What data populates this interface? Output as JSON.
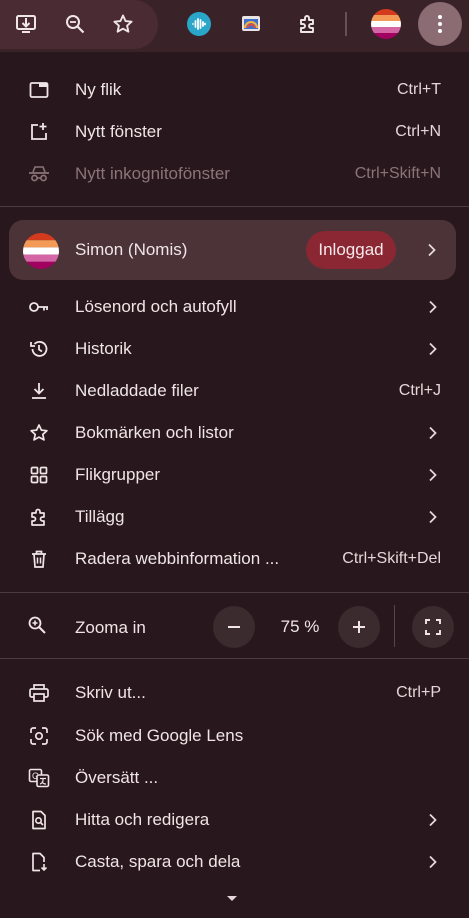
{
  "toolbar": {
    "icons": [
      "download-icon",
      "zoom-icon",
      "bookmark-star-icon",
      "extension-audio-icon",
      "extension-cast-icon",
      "extensions-puzzle-icon",
      "profile-avatar",
      "kebab-menu-icon"
    ]
  },
  "menu": {
    "new_tab": {
      "label": "Ny flik",
      "shortcut": "Ctrl+T"
    },
    "new_window": {
      "label": "Nytt fönster",
      "shortcut": "Ctrl+N"
    },
    "incognito": {
      "label": "Nytt inkognitofönster",
      "shortcut": "Ctrl+Skift+N"
    },
    "profile": {
      "name": "Simon (Nomis)",
      "status": "Inloggad"
    },
    "passwords": {
      "label": "Lösenord och autofyll"
    },
    "history": {
      "label": "Historik"
    },
    "downloads": {
      "label": "Nedladdade filer",
      "shortcut": "Ctrl+J"
    },
    "bookmarks": {
      "label": "Bokmärken och listor"
    },
    "tab_groups": {
      "label": "Flikgrupper"
    },
    "extensions": {
      "label": "Tillägg"
    },
    "clear_data": {
      "label": "Radera webbinformation ...",
      "shortcut": "Ctrl+Skift+Del"
    },
    "zoom": {
      "label": "Zooma in",
      "value": "75 %"
    },
    "print": {
      "label": "Skriv ut...",
      "shortcut": "Ctrl+P"
    },
    "lens": {
      "label": "Sök med Google Lens"
    },
    "translate": {
      "label": "Översätt ..."
    },
    "find": {
      "label": "Hitta och redigera"
    },
    "cast": {
      "label": "Casta, spara och dela"
    }
  },
  "colors": {
    "background": "#28171c",
    "profile_row": "#4b3338",
    "badge": "#8b2733",
    "toolbar": "#3a2229"
  }
}
